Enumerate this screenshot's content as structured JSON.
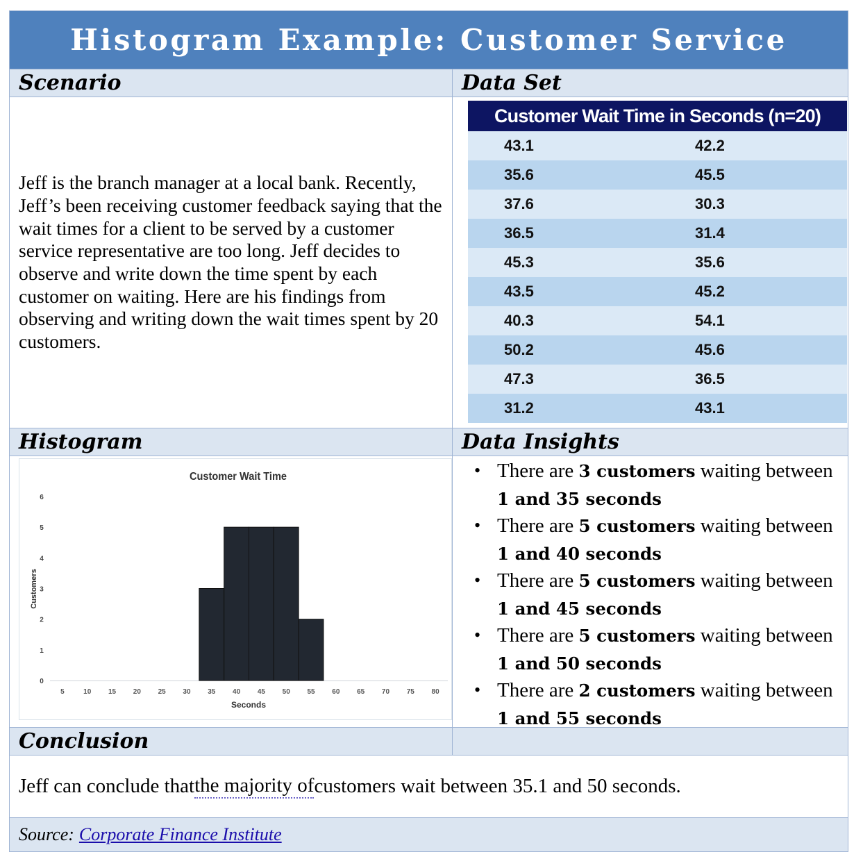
{
  "title": "Histogram Example: Customer Service",
  "sections": {
    "scenario": "Scenario",
    "dataset": "Data Set",
    "histogram": "Histogram",
    "insights": "Data Insights",
    "conclusion": "Conclusion"
  },
  "scenario_text": "Jeff is the branch manager at a local bank. Recently, Jeff’s been receiving customer feedback saying that the wait times for a client to be served by a customer service representative are too long. Jeff decides to observe and write down the time spent by each customer on waiting. Here are his findings from observing and writing down the wait times spent by 20 customers.",
  "dataset": {
    "header": "Customer Wait Time in Seconds (n=20)",
    "rows": [
      [
        "43.1",
        "42.2"
      ],
      [
        "35.6",
        "45.5"
      ],
      [
        "37.6",
        "30.3"
      ],
      [
        "36.5",
        "31.4"
      ],
      [
        "45.3",
        "35.6"
      ],
      [
        "43.5",
        "45.2"
      ],
      [
        "40.3",
        "54.1"
      ],
      [
        "50.2",
        "45.6"
      ],
      [
        "47.3",
        "36.5"
      ],
      [
        "31.2",
        "43.1"
      ]
    ]
  },
  "insights": [
    {
      "pre": "There are ",
      "count": "3 customers",
      "mid": " waiting between ",
      "range": "1 and 35 seconds"
    },
    {
      "pre": "There are ",
      "count": "5 customers",
      "mid": " waiting between ",
      "range": "1 and 40 seconds"
    },
    {
      "pre": "There are ",
      "count": "5 customers",
      "mid": " waiting between ",
      "range": "1 and 45 seconds"
    },
    {
      "pre": "There are ",
      "count": "5 customers",
      "mid": " waiting between ",
      "range": "1 and 50 seconds"
    },
    {
      "pre": "There are ",
      "count": "2 customers",
      "mid": " waiting between ",
      "range": "1 and 55 seconds"
    }
  ],
  "conclusion": {
    "pre": "Jeff can conclude that ",
    "highlight": "the majority of",
    "post": " customers wait between 35.1 and 50 seconds."
  },
  "source": {
    "label": "Source:",
    "link_text": "Corporate Finance Institute"
  },
  "colors": {
    "title_bar": "#4f81bd",
    "section_header": "#dbe5f1",
    "table_header": "#0d1562",
    "row_light": "#dbe9f6",
    "row_dark": "#b9d5ee",
    "bar": "#222831"
  },
  "chart_data": {
    "type": "bar",
    "title": "Customer Wait Time",
    "xlabel": "Seconds",
    "ylabel": "Customers",
    "categories": [
      "5",
      "10",
      "15",
      "20",
      "25",
      "30",
      "35",
      "40",
      "45",
      "50",
      "55",
      "60",
      "65",
      "70",
      "75",
      "80"
    ],
    "values": [
      0,
      0,
      0,
      0,
      0,
      0,
      3,
      5,
      5,
      5,
      2,
      0,
      0,
      0,
      0,
      0
    ],
    "yticks": [
      "0",
      "1",
      "2",
      "3",
      "4",
      "5",
      "6"
    ],
    "ylim": [
      0,
      6
    ],
    "grid": false,
    "legend": "none"
  }
}
